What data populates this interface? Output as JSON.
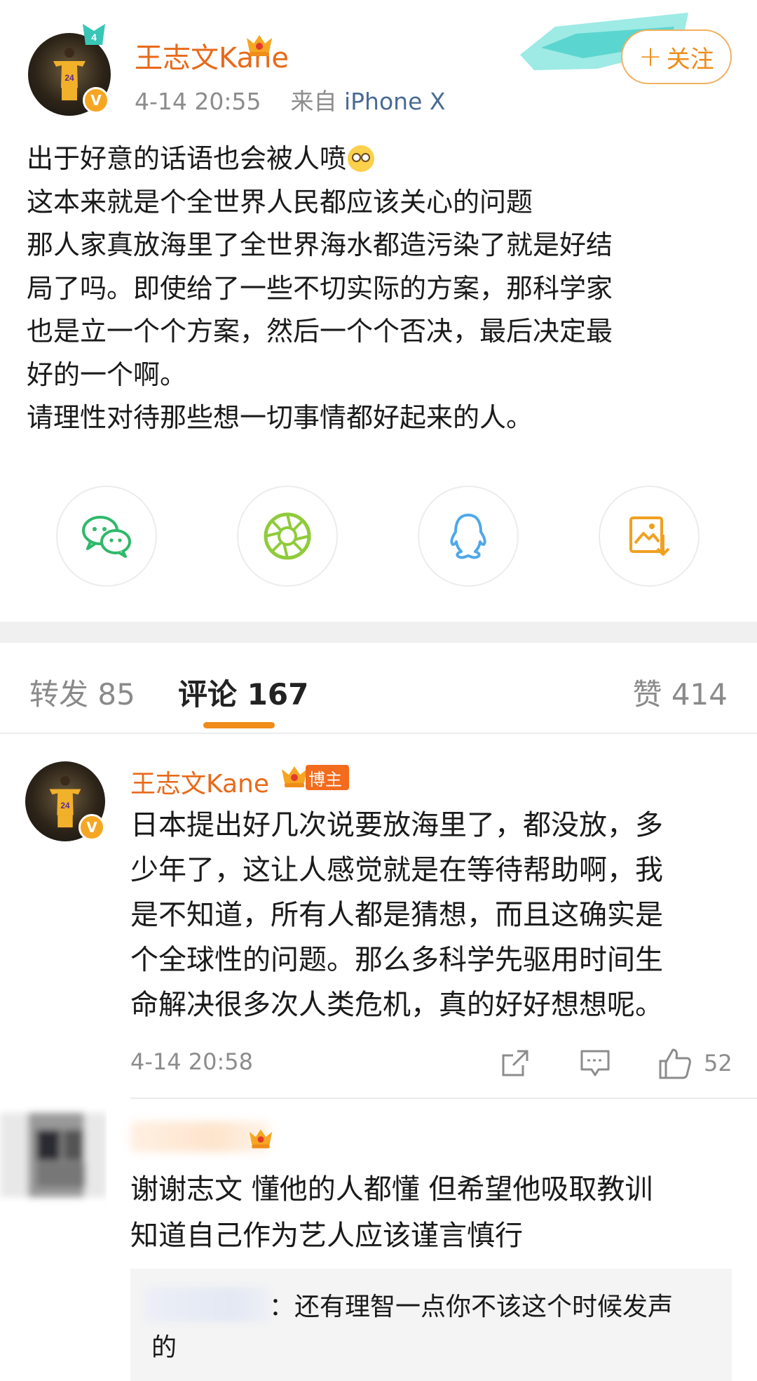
{
  "post": {
    "username": "王志文Kane",
    "timestamp": "4-14 20:55",
    "source_prefix": "来自",
    "device": "iPhone X",
    "follow_label": "关注",
    "follow_plus": "+",
    "verified_mark": "V",
    "body_lines": [
      "出于好意的话语也会被人喷",
      "这本来就是个全世界人民都应该关心的问题",
      "那人家真放海里了全世界海水都造污染了就是好结",
      "局了吗。即使给了一些不切实际的方案，那科学家",
      "也是立一个个方案，然后一个个否决，最后决定最",
      "好的一个啊。",
      "请理性对待那些想一切事情都好起来的人。"
    ]
  },
  "share": {
    "items": [
      {
        "name": "wechat-icon",
        "color": "#2fb96a"
      },
      {
        "name": "moments-icon",
        "color": "#8fcb3a"
      },
      {
        "name": "qq-icon",
        "color": "#4fa8e8"
      },
      {
        "name": "save-image-icon",
        "color": "#f0a020"
      }
    ]
  },
  "tabs": {
    "repost": "转发 85",
    "comments": "评论 167",
    "likes": "赞 414"
  },
  "comment": {
    "username": "王志文Kane",
    "host_tag": "博主",
    "verified_mark": "V",
    "text_lines": [
      "日本提出好几次说要放海里了，都没放，多",
      "少年了，这让人感觉就是在等待帮助啊，我",
      "是不知道，所有人都是猜想，而且这确实是",
      "个全球性的问题。那么多科学先驱用时间生",
      "命解决很多次人类危机，真的好好想想呢。"
    ],
    "timestamp": "4-14 20:58",
    "like_count": "52"
  },
  "reply": {
    "text_lines": [
      "谢谢志文 懂他的人都懂 但希望他吸取教训",
      "知道自己作为艺人应该谨言慎行"
    ],
    "sub_reply_lines": [
      "：还有理智一点你不该这个时候发声",
      "的"
    ]
  },
  "colors": {
    "accent": "#f08c1a",
    "username": "#e86a1a",
    "meta": "#8c8c8c",
    "device_link": "#4a6a95"
  }
}
